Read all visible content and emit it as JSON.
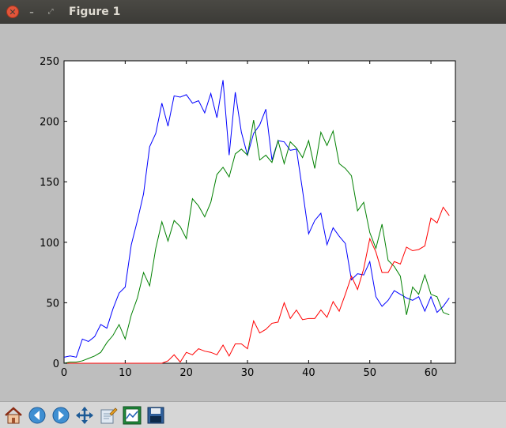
{
  "window": {
    "title": "Figure 1",
    "close_glyph": "✕",
    "min_glyph": "–",
    "max_glyph": "⤢"
  },
  "toolbar": {
    "buttons": [
      {
        "icon": "home-icon",
        "name": "home-button"
      },
      {
        "icon": "back-arrow-icon",
        "name": "back-button"
      },
      {
        "icon": "forward-arrow-icon",
        "name": "forward-button"
      },
      {
        "icon": "pan-arrows-icon",
        "name": "pan-button"
      },
      {
        "icon": "zoom-rect-icon",
        "name": "zoom-button"
      },
      {
        "icon": "subplots-config-icon",
        "name": "subplots-button"
      },
      {
        "icon": "floppy-disk-icon",
        "name": "save-button"
      }
    ]
  },
  "chart_data": {
    "type": "line",
    "xlim": [
      0,
      64
    ],
    "ylim": [
      0,
      250
    ],
    "xticks": [
      0,
      10,
      20,
      30,
      40,
      50,
      60
    ],
    "yticks": [
      0,
      50,
      100,
      150,
      200,
      250
    ],
    "grid": false,
    "series": [
      {
        "color": "#0000ff",
        "x": [
          0,
          1,
          2,
          3,
          4,
          5,
          6,
          7,
          8,
          9,
          10,
          11,
          12,
          13,
          14,
          15,
          16,
          17,
          18,
          19,
          20,
          21,
          22,
          23,
          24,
          25,
          26,
          27,
          28,
          29,
          30,
          31,
          32,
          33,
          34,
          35,
          36,
          37,
          38,
          39,
          40,
          41,
          42,
          43,
          44,
          45,
          46,
          47,
          48,
          49,
          50,
          51,
          52,
          53,
          54,
          55,
          56,
          57,
          58,
          59,
          60,
          61,
          62,
          63
        ],
        "values": [
          5,
          6,
          5,
          20,
          18,
          22,
          32,
          29,
          45,
          58,
          63,
          98,
          118,
          140,
          179,
          190,
          215,
          196,
          221,
          220,
          222,
          215,
          217,
          207,
          223,
          203,
          234,
          172,
          224,
          191,
          172,
          190,
          197,
          210,
          168,
          184,
          183,
          176,
          177,
          143,
          107,
          118,
          124,
          98,
          112,
          105,
          99,
          69,
          74,
          73,
          84,
          55,
          47,
          52,
          60,
          57,
          54,
          52,
          55,
          43,
          55,
          42,
          47,
          54
        ]
      },
      {
        "color": "#008000",
        "x": [
          0,
          1,
          2,
          3,
          4,
          5,
          6,
          7,
          8,
          9,
          10,
          11,
          12,
          13,
          14,
          15,
          16,
          17,
          18,
          19,
          20,
          21,
          22,
          23,
          24,
          25,
          26,
          27,
          28,
          29,
          30,
          31,
          32,
          33,
          34,
          35,
          36,
          37,
          38,
          39,
          40,
          41,
          42,
          43,
          44,
          45,
          46,
          47,
          48,
          49,
          50,
          51,
          52,
          53,
          54,
          55,
          56,
          57,
          58,
          59,
          60,
          61,
          62,
          63
        ],
        "values": [
          0,
          1,
          1,
          2,
          4,
          6,
          9,
          17,
          23,
          32,
          20,
          40,
          54,
          75,
          64,
          95,
          117,
          101,
          118,
          113,
          103,
          136,
          130,
          121,
          133,
          156,
          162,
          154,
          173,
          177,
          172,
          201,
          168,
          172,
          166,
          184,
          165,
          183,
          178,
          170,
          184,
          161,
          191,
          180,
          192,
          165,
          161,
          155,
          126,
          133,
          108,
          95,
          115,
          85,
          80,
          72,
          40,
          63,
          57,
          73,
          57,
          55,
          42,
          40
        ]
      },
      {
        "color": "#ff0000",
        "x": [
          0,
          1,
          2,
          3,
          4,
          5,
          6,
          7,
          8,
          9,
          10,
          11,
          12,
          13,
          14,
          15,
          16,
          17,
          18,
          19,
          20,
          21,
          22,
          23,
          24,
          25,
          26,
          27,
          28,
          29,
          30,
          31,
          32,
          33,
          34,
          35,
          36,
          37,
          38,
          39,
          40,
          41,
          42,
          43,
          44,
          45,
          46,
          47,
          48,
          49,
          50,
          51,
          52,
          53,
          54,
          55,
          56,
          57,
          58,
          59,
          60,
          61,
          62,
          63
        ],
        "values": [
          0,
          0,
          0,
          0,
          0,
          0,
          0,
          0,
          0,
          0,
          0,
          0,
          0,
          0,
          0,
          0,
          0,
          2,
          7,
          1,
          9,
          7,
          12,
          10,
          9,
          7,
          15,
          6,
          16,
          16,
          12,
          35,
          25,
          28,
          33,
          34,
          50,
          37,
          44,
          36,
          37,
          37,
          44,
          38,
          51,
          43,
          57,
          72,
          61,
          78,
          103,
          92,
          75,
          75,
          84,
          82,
          96,
          93,
          94,
          97,
          120,
          116,
          129,
          122
        ]
      }
    ]
  }
}
